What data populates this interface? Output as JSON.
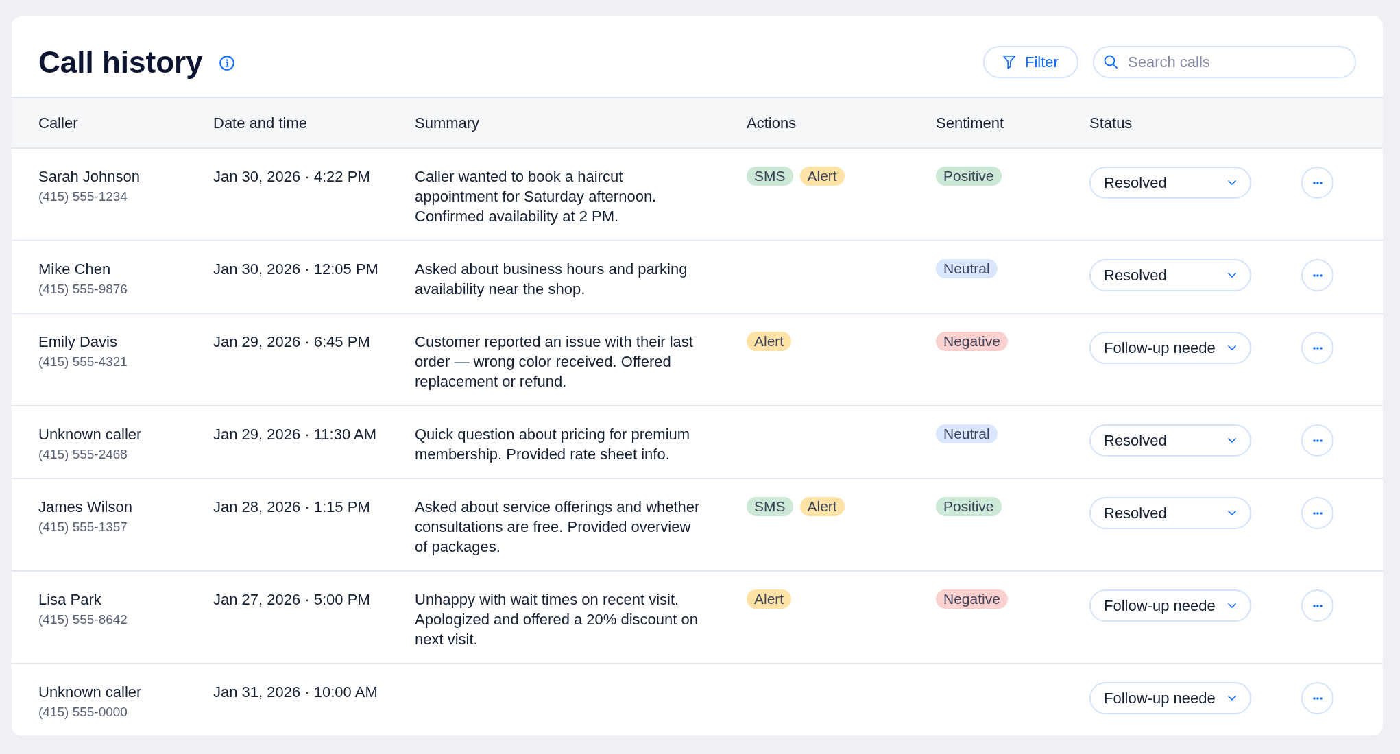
{
  "header": {
    "title": "Call history",
    "filter_button": "Filter",
    "search": {
      "placeholder": "Search calls"
    }
  },
  "table": {
    "columns": [
      "Caller",
      "Date and time",
      "Summary",
      "Actions",
      "Sentiment",
      "Status"
    ],
    "rows": [
      {
        "caller": "Sarah Johnson",
        "phone": "(415) 555-1234",
        "date_time": "Jan 30, 2026 · 4:22 PM",
        "summary": "Caller wanted to book a haircut appointment for Saturday afternoon. Confirmed availability at 2 PM.",
        "actions": [
          {
            "label": "SMS",
            "color": "#cbe9d6"
          },
          {
            "label": "Alert",
            "color": "#fee2a6"
          }
        ],
        "sentiment": {
          "label": "Positive",
          "color": "#cbe9d6"
        },
        "status": "Resolved"
      },
      {
        "caller": "Mike Chen",
        "phone": "(415) 555-9876",
        "date_time": "Jan 30, 2026 · 12:05 PM",
        "summary": "Asked about business hours and parking availability near the shop.",
        "sentiment": {
          "label": "Neutral",
          "color": "#dae6fb"
        },
        "status": "Resolved"
      },
      {
        "caller": "Emily Davis",
        "phone": "(415) 555-4321",
        "date_time": "Jan 29, 2026 · 6:45 PM",
        "summary": "Customer reported an issue with their last order — wrong color received. Offered replacement or refund.",
        "actions": [
          {
            "label": "Alert",
            "color": "#fee2a6"
          }
        ],
        "sentiment": {
          "label": "Negative",
          "color": "#fbd1d0"
        },
        "status": "Follow-up neede"
      },
      {
        "caller": "Unknown caller",
        "phone": "(415) 555-2468",
        "date_time": "Jan 29, 2026 · 11:30 AM",
        "summary": "Quick question about pricing for premium membership. Provided rate sheet info.",
        "sentiment": {
          "label": "Neutral",
          "color": "#dae6fb"
        },
        "status": "Resolved"
      },
      {
        "caller": "James Wilson",
        "phone": "(415) 555-1357",
        "date_time": "Jan 28, 2026 · 1:15 PM",
        "summary": "Asked about service offerings and whether consultations are free. Provided overview of packages.",
        "actions": [
          {
            "label": "SMS",
            "color": "#cbe9d6"
          },
          {
            "label": "Alert",
            "color": "#fee2a6"
          }
        ],
        "sentiment": {
          "label": "Positive",
          "color": "#cbe9d6"
        },
        "status": "Resolved"
      },
      {
        "caller": "Lisa Park",
        "phone": "(415) 555-8642",
        "date_time": "Jan 27, 2026 · 5:00 PM",
        "summary": "Unhappy with wait times on recent visit. Apologized and offered a 20% discount on next visit.",
        "actions": [
          {
            "label": "Alert",
            "color": "#fee2a6"
          }
        ],
        "sentiment": {
          "label": "Negative",
          "color": "#fbd1d0"
        },
        "status": "Follow-up neede"
      },
      {
        "caller": "Unknown caller",
        "phone": "(415) 555-0000",
        "date_time": "Jan 31, 2026 · 10:00 AM",
        "status": "Follow-up neede"
      }
    ]
  }
}
